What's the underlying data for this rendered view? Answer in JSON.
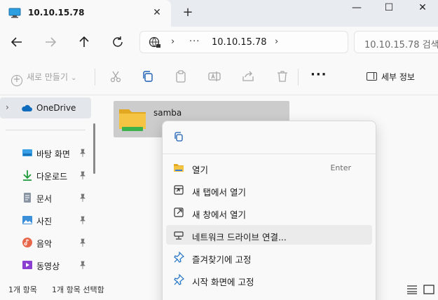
{
  "tab": {
    "title": "10.10.15.78",
    "close_glyph": "✕",
    "new_tab_glyph": "+"
  },
  "window_controls": {
    "minimize": "—",
    "maximize": "☐",
    "close": "✕"
  },
  "address": {
    "path": "10.10.15.78"
  },
  "search": {
    "placeholder": "10.10.15.78 검색"
  },
  "toolbar": {
    "new_label": "새로 만들기",
    "details_label": "세부 정보",
    "more_label": "···"
  },
  "sidebar": {
    "items": [
      {
        "label": "OneDrive",
        "icon": "cloud-icon"
      },
      {
        "label": "바탕 화면",
        "icon": "desktop-icon"
      },
      {
        "label": "다운로드",
        "icon": "download-icon"
      },
      {
        "label": "문서",
        "icon": "document-icon"
      },
      {
        "label": "사진",
        "icon": "pictures-icon"
      },
      {
        "label": "음악",
        "icon": "music-icon"
      },
      {
        "label": "동영상",
        "icon": "videos-icon"
      }
    ]
  },
  "content": {
    "files": [
      {
        "name": "samba",
        "type": "network-share-folder"
      }
    ]
  },
  "context_menu": {
    "items": [
      {
        "label": "열기",
        "accelerator": "Enter",
        "icon": "open-folder-icon"
      },
      {
        "label": "새 탭에서 열기",
        "accelerator": "",
        "icon": "new-tab-icon"
      },
      {
        "label": "새 창에서 열기",
        "accelerator": "",
        "icon": "new-window-icon"
      },
      {
        "label": "네트워크 드라이브 연결...",
        "accelerator": "",
        "icon": "map-drive-icon"
      },
      {
        "label": "즐겨찾기에 고정",
        "accelerator": "",
        "icon": "pin-icon"
      },
      {
        "label": "시작 화면에 고정",
        "accelerator": "",
        "icon": "pin-icon"
      }
    ]
  },
  "status": {
    "item_count": "1개 항목",
    "selected_count": "1개 항목 선택함"
  },
  "colors": {
    "accent": "#0067c0",
    "folder": "#f6c443",
    "share_bar": "#3bb34a"
  }
}
